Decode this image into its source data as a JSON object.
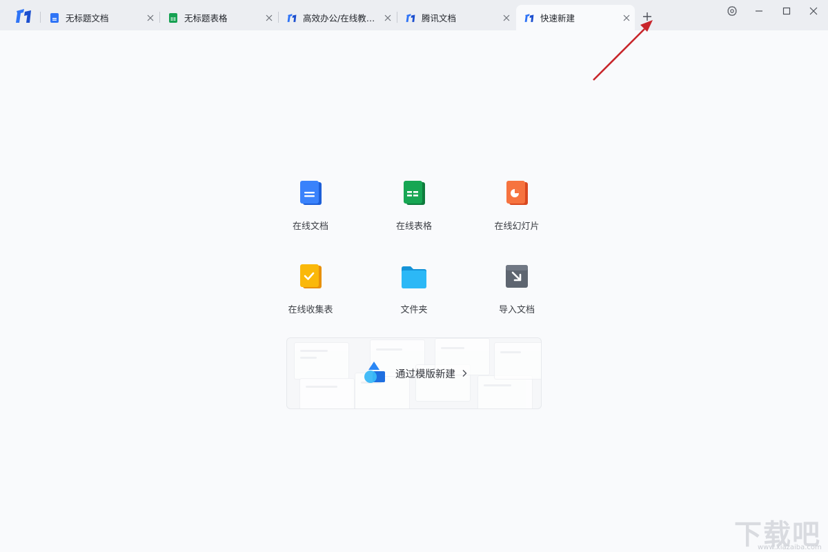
{
  "tabs": [
    {
      "label": "无标题文档",
      "icon": "doc-icon",
      "active": false
    },
    {
      "label": "无标题表格",
      "icon": "sheet-icon",
      "active": false
    },
    {
      "label": "高效办公/在线教育...",
      "icon": "app-logo-icon",
      "active": false
    },
    {
      "label": "腾讯文档",
      "icon": "app-logo-icon",
      "active": false
    },
    {
      "label": "快速新建",
      "icon": "app-logo-icon",
      "active": true
    }
  ],
  "tiles": [
    {
      "label": "在线文档",
      "icon": "online-doc-icon",
      "color": "#2f74f6"
    },
    {
      "label": "在线表格",
      "icon": "online-sheet-icon",
      "color": "#16a152"
    },
    {
      "label": "在线幻灯片",
      "icon": "online-slides-icon",
      "color": "#f4683d"
    },
    {
      "label": "在线收集表",
      "icon": "online-form-icon",
      "color": "#f7b500"
    },
    {
      "label": "文件夹",
      "icon": "folder-icon",
      "color": "#27b3f5"
    },
    {
      "label": "导入文档",
      "icon": "import-doc-icon",
      "color": "#5e6570"
    }
  ],
  "template": {
    "label": "通过模版新建",
    "icon": "template-shapes-icon"
  },
  "watermark": {
    "title": "下载吧",
    "url": "www.xiazaiba.com"
  },
  "colors": {
    "brand": "#2f74f6",
    "arrow": "#c8252b",
    "titlebar": "#eceef2",
    "background": "#f9fafc"
  }
}
